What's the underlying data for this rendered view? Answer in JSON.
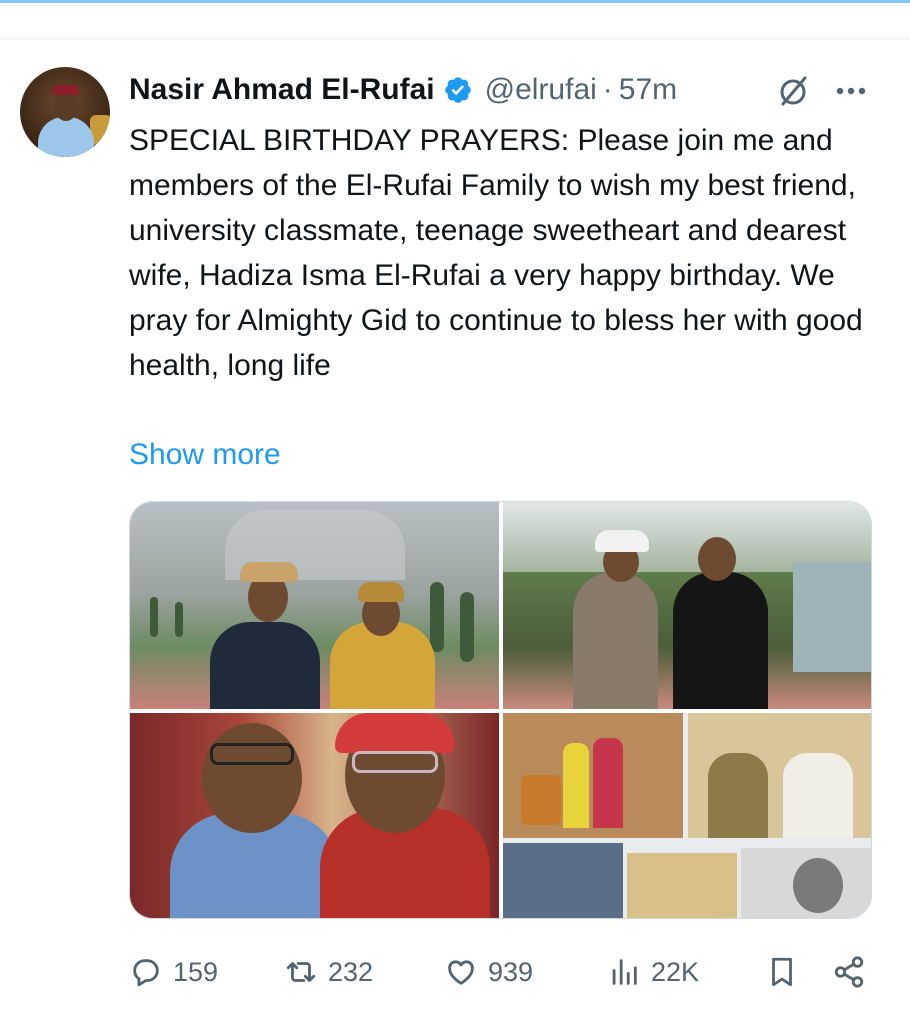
{
  "tweet": {
    "author_name": "Nasir Ahmad El-Rufai",
    "handle": "@elrufai",
    "separator": "·",
    "time": "57m",
    "text": "SPECIAL BIRTHDAY PRAYERS: Please join me and members of the El-Rufai Family to wish my best friend, university classmate, teenage sweetheart and dearest wife, Hadiza Isma El-Rufai a very happy birthday. We pray for Almighty Gid to continue to bless her with good health, long life",
    "show_more": "Show more",
    "icons": {
      "verified": "verified-badge-icon",
      "grok": "grok-icon",
      "more": "more-options-icon"
    },
    "media": {
      "photo_count": 4,
      "photos": [
        "photo-garden-couple",
        "photo-outdoor-couple",
        "photo-library-couple",
        "photo-collage-family"
      ]
    },
    "actions": {
      "replies": "159",
      "reposts": "232",
      "likes": "939",
      "views": "22K"
    },
    "colors": {
      "accent": "#1d9bf0",
      "text_primary": "#0f1419",
      "text_secondary": "#536471"
    }
  }
}
